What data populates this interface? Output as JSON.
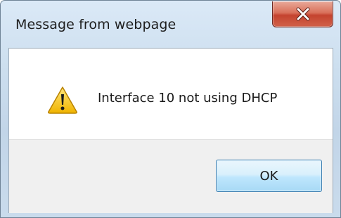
{
  "window": {
    "title": "Message from webpage",
    "close_icon": "close-icon",
    "close_color": "#c8442f"
  },
  "dialog": {
    "icon": "warning-icon",
    "icon_color": "#f2c200",
    "message": "Interface 10 not using DHCP",
    "ok_label": "OK"
  }
}
